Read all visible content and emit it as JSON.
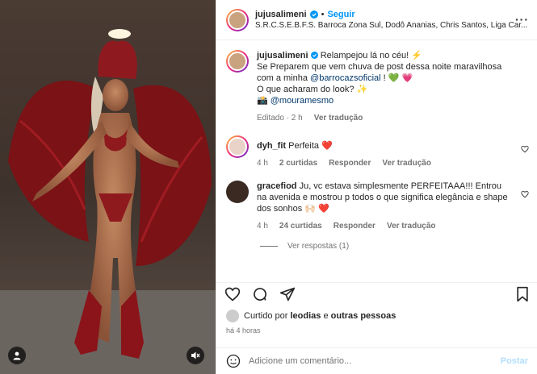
{
  "post": {
    "author": "jujusalimeni",
    "follow_label": "Seguir",
    "location": "S.R.C.S.E.B.F.S. Barroca Zona Sul, Dodô Ananias, Chris Santos, Liga Car...",
    "caption": {
      "line1": "Relampejou lá no céu! ⚡",
      "line2": "Se Preparem que vem chuva de post dessa noite maravilhosa",
      "line3_pre": "com a minha ",
      "mention1": "@barrocazsoficial",
      "line3_post": " ! 💚 💗",
      "line4": "O que acharam do look? ✨",
      "credit_prefix": "📸 ",
      "mention2": "@mouramesmo",
      "meta_edited": "Editado · 2 h",
      "meta_translate": "Ver tradução"
    }
  },
  "comments": [
    {
      "user": "dyh_fit",
      "text": "Perfeita ❤️",
      "time": "4 h",
      "likes": "2 curtidas",
      "reply": "Responder",
      "translate": "Ver tradução"
    },
    {
      "user": "gracefiod",
      "text": "Ju, vc estava simplesmente PERFEITAAA!!! Entrou na avenida e mostrou p todos o que significa elegância e shape dos sonhos 🙌🏻 ❤️",
      "time": "4 h",
      "likes": "24 curtidas",
      "reply": "Responder",
      "translate": "Ver tradução",
      "view_replies": "Ver respostas (1)"
    }
  ],
  "likes": {
    "prefix": "Curtido por ",
    "user": "leodias",
    "middle": " e ",
    "others": "outras pessoas"
  },
  "time_ago": "há 4 horas",
  "add_comment": {
    "placeholder": "Adicione um comentário...",
    "post_label": "Postar"
  },
  "colors": {
    "accent": "#0095f6",
    "link": "#00376b",
    "heart": "#ed4956",
    "muted": "#737373"
  },
  "icons": [
    "heart-icon",
    "comment-icon",
    "share-icon",
    "bookmark-icon",
    "emoji-icon",
    "more-icon",
    "verified-icon",
    "user-icon",
    "mute-icon"
  ]
}
